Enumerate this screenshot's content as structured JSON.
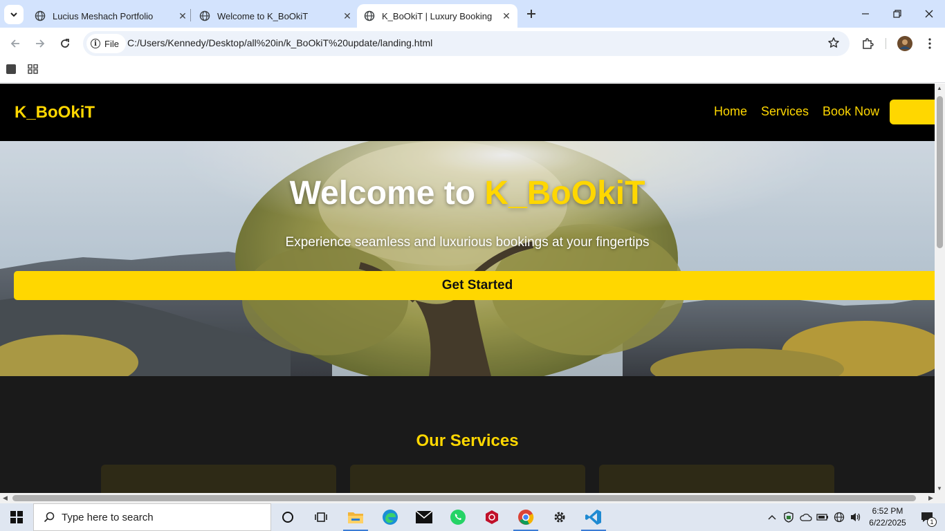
{
  "browser": {
    "tabs": [
      {
        "title": "Lucius Meshach Portfolio",
        "active": false
      },
      {
        "title": "Welcome to K_BoOkiT",
        "active": false
      },
      {
        "title": "K_BoOkiT | Luxury Booking",
        "active": true
      }
    ],
    "address": {
      "scheme_label": "File",
      "url": "C:/Users/Kennedy/Desktop/all%20in/k_BoOkiT%20update/landing.html"
    },
    "icons": {
      "tab_search": "chevron-down-icon",
      "favicon": "globe-icon",
      "close": "close-icon",
      "new_tab": "plus-icon",
      "back": "arrow-left-icon",
      "forward": "arrow-right-icon",
      "reload": "reload-icon",
      "bookmark": "star-icon",
      "extensions": "puzzle-icon",
      "menu": "kebab-icon"
    }
  },
  "site": {
    "logo": "K_BoOkiT",
    "nav": [
      "Home",
      "Services",
      "Book Now"
    ],
    "hero": {
      "title_prefix": "Welcome to ",
      "title_brand": "K_BoOkiT",
      "subtitle": "Experience seamless and luxurious bookings at your fingertips",
      "cta": "Get Started"
    },
    "services_heading": "Our Services",
    "colors": {
      "accent": "#ffd700",
      "nav_bg": "#000000",
      "section_bg": "#1a1a1a"
    }
  },
  "taskbar": {
    "search_placeholder": "Type here to search",
    "time": "6:52 PM",
    "date": "6/22/2025",
    "notification_count": "1",
    "apps": [
      "cortana-icon",
      "task-view-icon",
      "file-explorer-icon",
      "edge-icon",
      "mail-icon",
      "whatsapp-icon",
      "app-icon",
      "chrome-icon",
      "settings-icon",
      "vscode-icon"
    ]
  }
}
